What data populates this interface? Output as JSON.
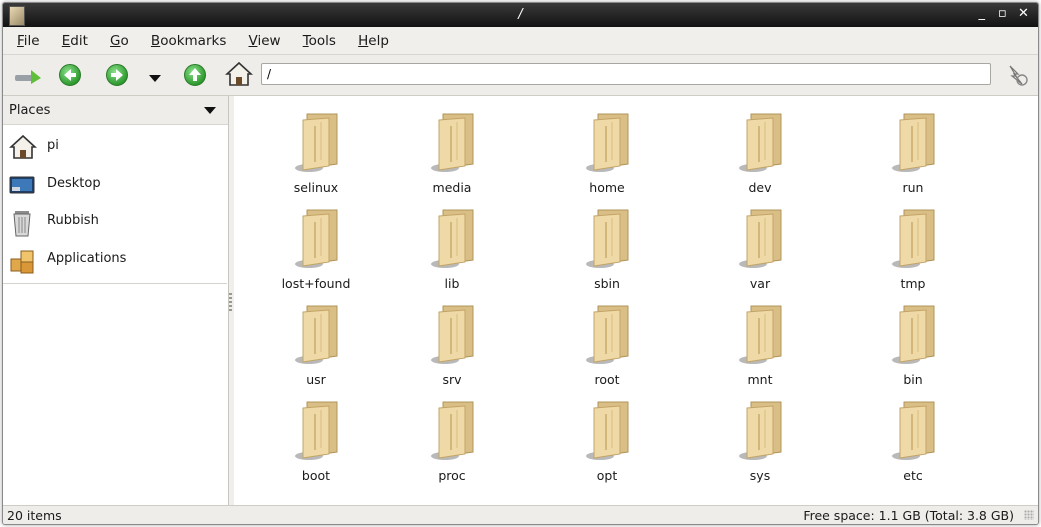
{
  "window": {
    "title": "/",
    "controls": [
      "_",
      "▫",
      "✕"
    ]
  },
  "menu": [
    "File",
    "Edit",
    "Go",
    "Bookmarks",
    "View",
    "Tools",
    "Help"
  ],
  "toolbar": {
    "address_value": "/",
    "icons": [
      "go-icon",
      "back-icon",
      "forward-icon",
      "history-dropdown-icon",
      "up-icon",
      "home-icon",
      "jump-icon"
    ]
  },
  "sidepane": {
    "header": "Places",
    "items": [
      {
        "label": "pi",
        "icon": "home-icon"
      },
      {
        "label": "Desktop",
        "icon": "desktop-icon"
      },
      {
        "label": "Rubbish",
        "icon": "trash-icon"
      },
      {
        "label": "Applications",
        "icon": "applications-icon"
      }
    ]
  },
  "folders": [
    "selinux",
    "media",
    "home",
    "dev",
    "run",
    "lost+found",
    "lib",
    "sbin",
    "var",
    "tmp",
    "usr",
    "srv",
    "root",
    "mnt",
    "bin",
    "boot",
    "proc",
    "opt",
    "sys",
    "etc"
  ],
  "status": {
    "count": "20 items",
    "free_space": "Free space: 1.1 GB (Total: 3.8 GB)"
  },
  "colors": {
    "titlebar": "#1e1e1e",
    "folder": "#e8cf97",
    "green_button": "#3aa83a"
  }
}
